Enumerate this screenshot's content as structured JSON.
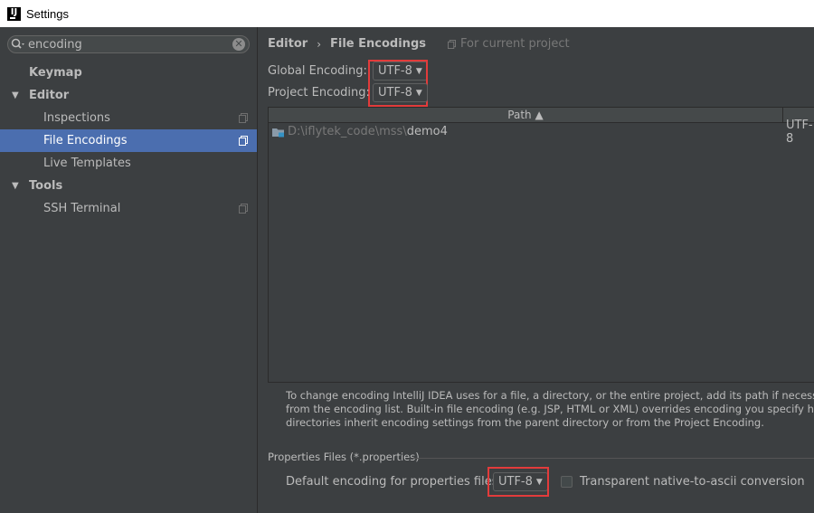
{
  "window": {
    "title": "Settings"
  },
  "sidebar": {
    "search": {
      "value": "encoding"
    },
    "items": [
      {
        "label": "Keymap"
      },
      {
        "label": "Editor"
      },
      {
        "label": "Inspections"
      },
      {
        "label": "File Encodings"
      },
      {
        "label": "Live Templates"
      },
      {
        "label": "Tools"
      },
      {
        "label": "SSH Terminal"
      }
    ],
    "selected": "File Encodings"
  },
  "breadcrumb": {
    "parent": "Editor",
    "separator": "›",
    "current": "File Encodings",
    "scope": "For current project"
  },
  "encodings": {
    "global_label": "Global Encoding:",
    "global_value": "UTF-8",
    "project_label": "Project Encoding:",
    "project_value": "UTF-8"
  },
  "table": {
    "path_header": "Path ▲",
    "rows": [
      {
        "path_prefix": "D:\\iflytek_code\\mss\\",
        "path_name": "demo4",
        "encoding": "UTF-8"
      }
    ]
  },
  "help": {
    "line1": "To change encoding IntelliJ IDEA uses for a file, a directory, or the entire project, add its path if necessary and th",
    "line2": "from the encoding list. Built-in file encoding (e.g. JSP, HTML or XML) overrides encoding you specify here. If no",
    "line3": "directories inherit encoding settings from the parent directory or from the Project Encoding."
  },
  "properties": {
    "section_title": "Properties Files (*.properties)",
    "default_label": "Default encoding for properties files:",
    "default_value": "UTF-8",
    "transparent_label": "Transparent native-to-ascii conversion",
    "transparent_checked": false
  },
  "colors": {
    "background": "#3c3f41",
    "selection": "#4b6eaf",
    "highlight_box": "#e23b3b"
  }
}
